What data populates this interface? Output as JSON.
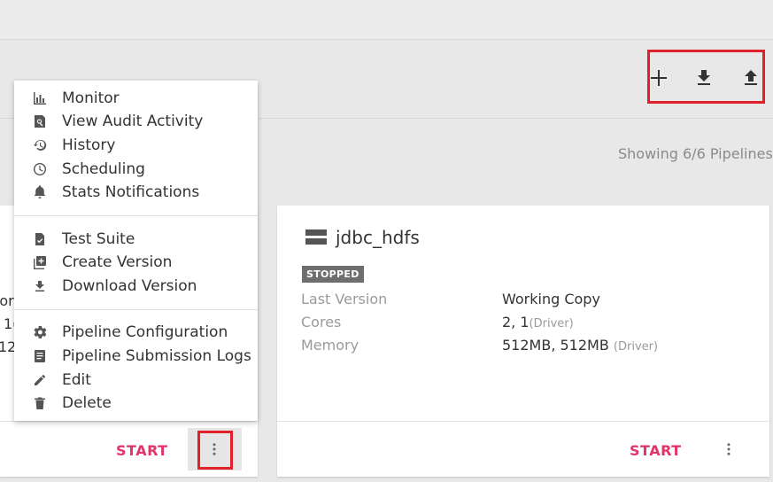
{
  "toolbar": {
    "showing_text": "Showing 6/6 Pipelines",
    "actions": [
      {
        "icon": "plus-icon",
        "label": ""
      },
      {
        "icon": "download-icon",
        "label": ""
      },
      {
        "icon": "upload-icon",
        "label": ""
      }
    ]
  },
  "menu": {
    "items": [
      {
        "label": "Monitor",
        "icon": "bar-chart-icon"
      },
      {
        "label": "View Audit Activity",
        "icon": "audit-search-icon"
      },
      {
        "label": "History",
        "icon": "history-icon"
      },
      {
        "label": "Scheduling",
        "icon": "clock-icon"
      },
      {
        "label": "Stats Notifications",
        "icon": "bell-icon"
      },
      {
        "label": "Test Suite",
        "icon": "test-suite-icon"
      },
      {
        "label": "Create Version",
        "icon": "add-box-icon"
      },
      {
        "label": "Download Version",
        "icon": "download-icon"
      },
      {
        "label": "Pipeline Configuration",
        "icon": "gear-icon"
      },
      {
        "label": "Pipeline Submission Logs",
        "icon": "log-icon"
      },
      {
        "label": "Edit",
        "icon": "pencil-icon"
      },
      {
        "label": "Delete",
        "icon": "trash-icon"
      }
    ]
  },
  "left_card": {
    "partial_lines": [
      "/or",
      "1(",
      "12"
    ],
    "start_label": "START"
  },
  "right_card": {
    "title": "jdbc_hdfs",
    "status": "STOPPED",
    "rows": [
      {
        "label": "Last Version",
        "value": "Working Copy",
        "sub": ""
      },
      {
        "label": "Cores",
        "value": "2, 1",
        "sub": "(Driver)"
      },
      {
        "label": "Memory",
        "value": "512MB, 512MB",
        "sub": "(Driver)"
      }
    ],
    "start_label": "START"
  },
  "colors": {
    "accent": "#e0356a",
    "highlight": "#e0202a",
    "badge": "#6e6e6e"
  }
}
